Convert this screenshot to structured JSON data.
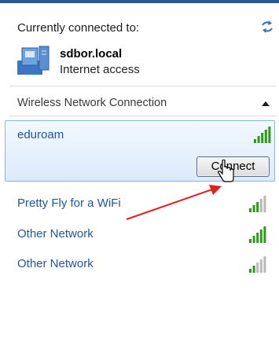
{
  "header": {
    "title": "Currently connected to:"
  },
  "current_connection": {
    "name": "sdbor.local",
    "status": "Internet access"
  },
  "wireless_section": {
    "title": "Wireless Network Connection"
  },
  "selected_network": {
    "name": "eduroam",
    "signal_bars": 5,
    "connect_label": "Connect"
  },
  "networks": [
    {
      "name": "Pretty Fly for a WiFi",
      "signal_bars": 3
    },
    {
      "name": "Other Network",
      "signal_bars": 5
    },
    {
      "name": "Other Network",
      "signal_bars": 2
    }
  ],
  "colors": {
    "accent": "#2b5797",
    "link": "#1f56a5",
    "signal_on": "#2d9a18",
    "signal_off": "#b8b8b8",
    "annotation_arrow": "#e02020"
  },
  "icons": [
    "refresh-icon",
    "network-computer-icon",
    "chevron-up-icon",
    "signal-strength-icon",
    "mouse-pointer-icon"
  ]
}
